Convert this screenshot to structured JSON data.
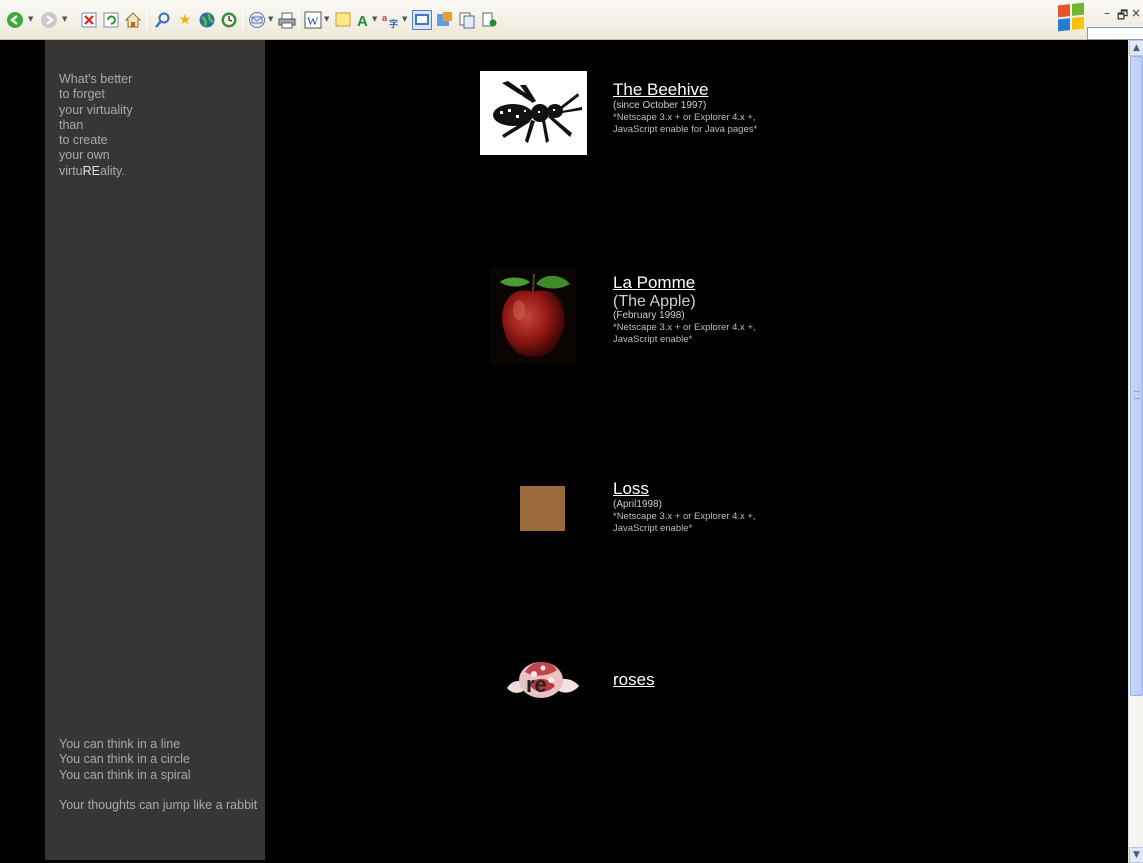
{
  "toolbar": {
    "icons": [
      "back-icon",
      "forward-icon",
      "stop-icon",
      "refresh-icon",
      "home-icon",
      "search-icon",
      "favorites-icon",
      "media-icon",
      "history-icon",
      "mail-icon",
      "print-icon",
      "edit-icon",
      "discuss-icon",
      "font-icon",
      "translate-icon",
      "screen-icon",
      "messenger-icon",
      "copy-icon",
      "research-icon"
    ]
  },
  "sidebar": {
    "poem_lines": [
      "What's better",
      "to forget",
      "your virtuality",
      "than",
      "to create",
      "your own"
    ],
    "last_line_prefix": "virtu",
    "last_line_highlight": "RE",
    "last_line_suffix": "ality.",
    "thoughts_lines": [
      "You can think in a line",
      "You can think in a circle",
      "You can think in a spiral"
    ],
    "thoughts_final": "Your thoughts can jump like a rabbit"
  },
  "entries": [
    {
      "title": "The Beehive",
      "date": "(since October 1997)",
      "note_1": "*Netscape 3.x + or Explorer 4.x +,",
      "note_2": "JavaScript enable for Java pages*"
    },
    {
      "title": "La Pomme",
      "subtitle": "(The Apple)",
      "date": "(February 1998)",
      "note_1": "*Netscape 3.x + or Explorer 4.x +,",
      "note_2": "JavaScript enable*"
    },
    {
      "title": "Loss",
      "date": "(April1998)",
      "note_1": "*Netscape 3.x + or Explorer 4.x +,",
      "note_2": "JavaScript enable*"
    },
    {
      "title": "roses",
      "image_text": "re"
    }
  ],
  "colors": {
    "page_bg": "#000000",
    "sidebar_bg": "#363636",
    "loss_square": "#9a6a3c",
    "sidebar_text": "#a9a9a9"
  }
}
